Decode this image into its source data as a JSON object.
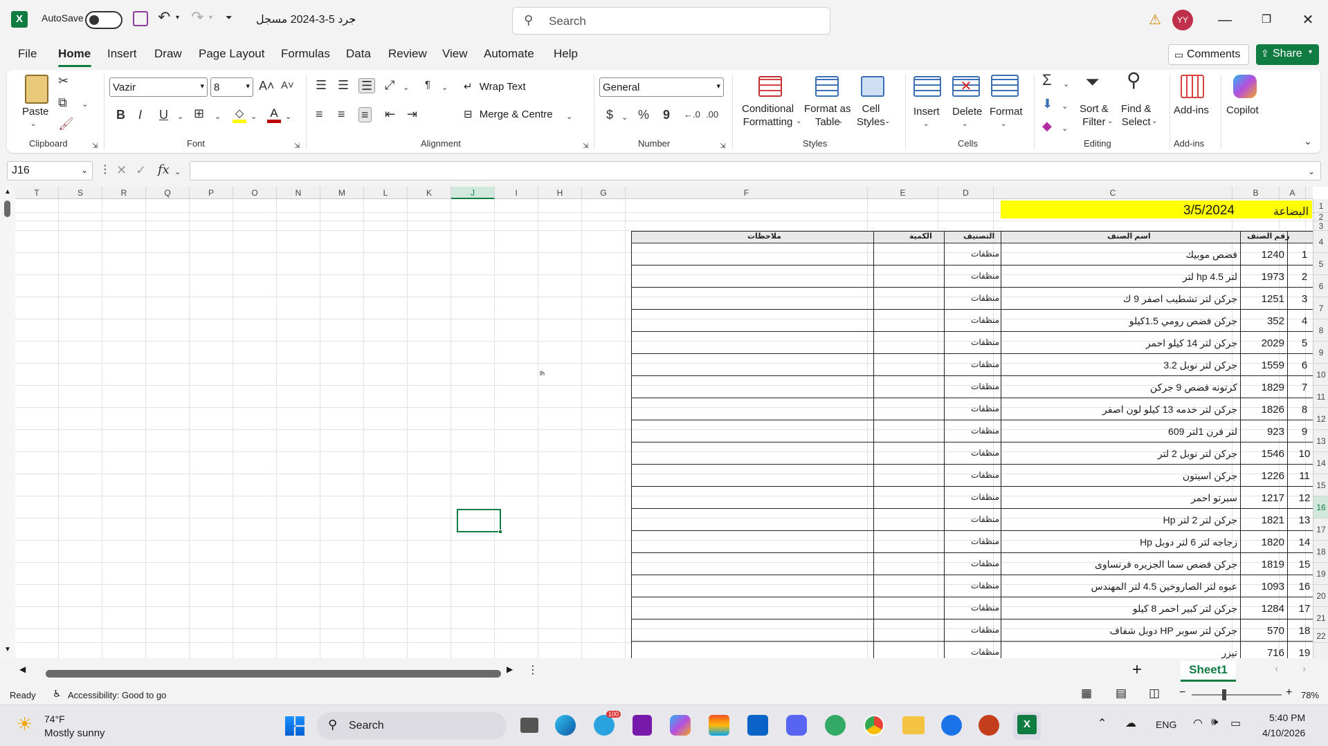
{
  "titlebar": {
    "autosave_label": "AutoSave",
    "file_title": "جرد 5-3-2024 مسجل",
    "search_placeholder": "Search",
    "user_initials": "YY"
  },
  "menu": {
    "tabs": [
      "File",
      "Home",
      "Insert",
      "Draw",
      "Page Layout",
      "Formulas",
      "Data",
      "Review",
      "View",
      "Automate",
      "Help"
    ],
    "comments_label": "Comments",
    "share_label": "Share"
  },
  "ribbon": {
    "clipboard": {
      "paste": "Paste",
      "group": "Clipboard"
    },
    "font": {
      "name": "Vazir",
      "size": "8",
      "group": "Font",
      "bold": "B",
      "italic": "I",
      "underline": "U"
    },
    "alignment": {
      "wrap_text": "Wrap Text",
      "merge_centre": "Merge & Centre",
      "group": "Alignment"
    },
    "number": {
      "format": "General",
      "group": "Number",
      "currency": "$",
      "percent": "%",
      "comma": "9"
    },
    "styles": {
      "conditional": "Conditional\nFormatting",
      "format_table": "Format as\nTable",
      "cell_styles": "Cell\nStyles",
      "group": "Styles"
    },
    "cells": {
      "insert": "Insert",
      "delete": "Delete",
      "format": "Format",
      "group": "Cells"
    },
    "editing": {
      "sort_filter": "Sort &\nFilter",
      "find_select": "Find &\nSelect",
      "group": "Editing"
    },
    "addins": {
      "addins": "Add-ins",
      "group": "Add-ins"
    },
    "copilot": {
      "label": "Copilot"
    }
  },
  "formula_bar": {
    "name_box": "J16",
    "fx": "fx",
    "value": ""
  },
  "columns": [
    "T",
    "S",
    "R",
    "Q",
    "P",
    "O",
    "N",
    "M",
    "L",
    "K",
    "J",
    "I",
    "H",
    "G",
    "F",
    "E",
    "D",
    "C",
    "B",
    "A"
  ],
  "selected_column": "J",
  "selected_row": "16",
  "rows_visible": [
    "1",
    "2",
    "3",
    "4",
    "5",
    "6",
    "7",
    "8",
    "9",
    "10",
    "11",
    "12",
    "13",
    "14",
    "15",
    "16",
    "17",
    "18",
    "19",
    "20",
    "21",
    "22"
  ],
  "sheet": {
    "header_label": "البضاعة",
    "header_date": "3/5/2024",
    "table_headers": {
      "notes": "ملاحظات",
      "quantity": "الكمية",
      "category": "التصنيف",
      "item_name": "اسم الصنف",
      "item_no": "رقم الصنف"
    },
    "stray_text": "lh",
    "rows": [
      {
        "n": "1",
        "code": "1240",
        "name": "فضص موبيك",
        "cat": "منظفات"
      },
      {
        "n": "2",
        "code": "1973",
        "name": "لتر hp 4.5 لتر",
        "cat": "منظفات"
      },
      {
        "n": "3",
        "code": "1251",
        "name": "جركن لتر تشطيب اصفر 9 ك",
        "cat": "منظفات"
      },
      {
        "n": "4",
        "code": "352",
        "name": "جركن فضص رومي 1.5كيلو",
        "cat": "منظفات"
      },
      {
        "n": "5",
        "code": "2029",
        "name": "جركن لتر 14 كيلو احمر",
        "cat": "منظفات"
      },
      {
        "n": "6",
        "code": "1559",
        "name": "جركن لتر نوبل 3.2",
        "cat": "منظفات"
      },
      {
        "n": "7",
        "code": "1829",
        "name": "كرتونه فضص 9 جركن",
        "cat": "منظفات"
      },
      {
        "n": "8",
        "code": "1826",
        "name": "جركن لتر خدمه 13 كيلو لون اصفر",
        "cat": "منظفات"
      },
      {
        "n": "9",
        "code": "923",
        "name": "لتر فرن 1لتر 609",
        "cat": "منظفات"
      },
      {
        "n": "10",
        "code": "1546",
        "name": "جركن لتر نوبل 2 لتر",
        "cat": "منظفات"
      },
      {
        "n": "11",
        "code": "1226",
        "name": "جركن اسيتون",
        "cat": "منظفات"
      },
      {
        "n": "12",
        "code": "1217",
        "name": "سبرتو احمر",
        "cat": "منظفات"
      },
      {
        "n": "13",
        "code": "1821",
        "name": "جركن لتر 2 لتر Hp",
        "cat": "منظفات"
      },
      {
        "n": "14",
        "code": "1820",
        "name": "زجاجه لتر 6 لتر دوبل Hp",
        "cat": "منظفات"
      },
      {
        "n": "15",
        "code": "1819",
        "name": "جركن فضص سما الجزيره فرنساوى",
        "cat": "منظفات"
      },
      {
        "n": "16",
        "code": "1093",
        "name": "عبوه لتر الصاروخين 4.5 لتر المهندس",
        "cat": "منظفات"
      },
      {
        "n": "17",
        "code": "1284",
        "name": "جركن لتر كبير احمر 8 كيلو",
        "cat": "منظفات"
      },
      {
        "n": "18",
        "code": "570",
        "name": "جركن لتر سوبر HP دوبل شفاف",
        "cat": "منظفات"
      },
      {
        "n": "19",
        "code": "716",
        "name": "تيزر",
        "cat": "منظفات"
      }
    ]
  },
  "sheet_tabs": {
    "active": "Sheet1"
  },
  "status": {
    "ready": "Ready",
    "accessibility": "Accessibility: Good to go",
    "zoom": "78%"
  },
  "taskbar": {
    "weather_temp": "74°F",
    "weather_desc": "Mostly sunny",
    "search": "Search",
    "lang": "ENG",
    "time": "5:40 PM",
    "date": "4/10/2026",
    "telegram_badge": "100"
  },
  "colors": {
    "excel_green": "#107c41",
    "highlight_yellow": "#ffff00",
    "selection": "#107c41"
  }
}
